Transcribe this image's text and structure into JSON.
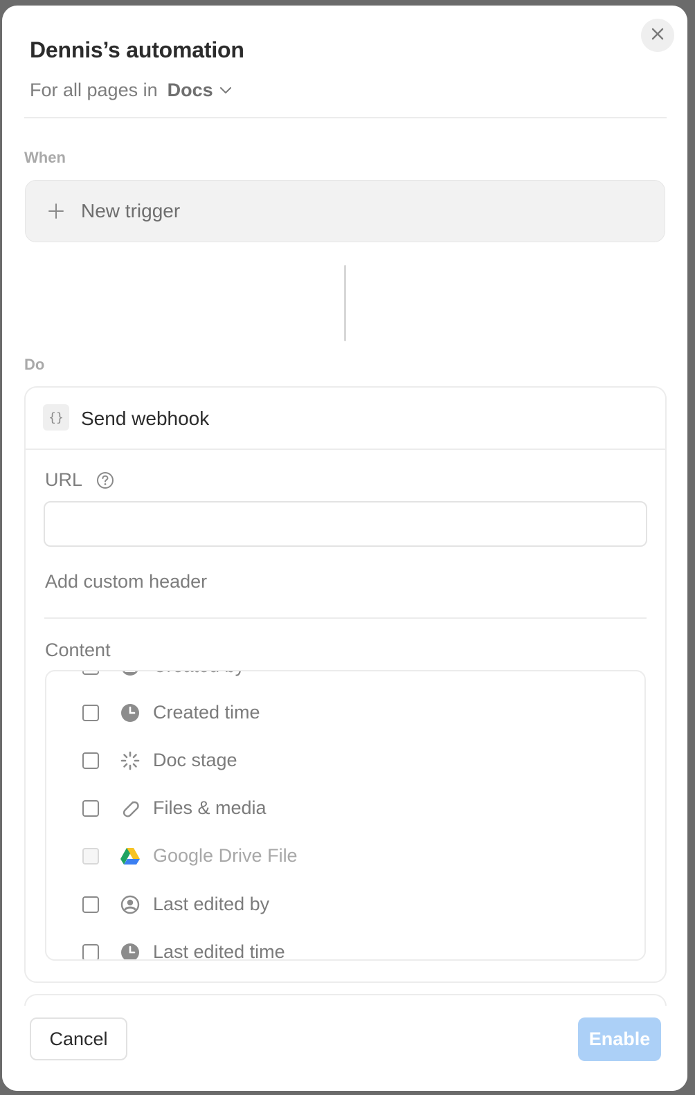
{
  "modal": {
    "title": "Dennis’s automation",
    "scope_prefix": "For all pages in",
    "scope_database": "Docs",
    "close_icon": "close-icon"
  },
  "when": {
    "label": "When",
    "new_trigger": "New trigger"
  },
  "do": {
    "label": "Do",
    "action": {
      "icon": "code-braces-icon",
      "icon_text": "{}",
      "title": "Send webhook",
      "url_label": "URL",
      "url_value": "",
      "add_header": "Add custom header",
      "content_label": "Content",
      "properties": [
        {
          "label": "Created by",
          "icon": "person-icon",
          "checked": false,
          "disabled": false
        },
        {
          "label": "Created time",
          "icon": "clock-icon",
          "checked": false,
          "disabled": false
        },
        {
          "label": "Doc stage",
          "icon": "status-icon",
          "checked": false,
          "disabled": false
        },
        {
          "label": "Files & media",
          "icon": "paperclip-icon",
          "checked": false,
          "disabled": false
        },
        {
          "label": "Google Drive File",
          "icon": "google-drive-icon",
          "checked": false,
          "disabled": true
        },
        {
          "label": "Last edited by",
          "icon": "person-icon",
          "checked": false,
          "disabled": false
        },
        {
          "label": "Last edited time",
          "icon": "clock-icon",
          "checked": false,
          "disabled": false
        }
      ]
    }
  },
  "footer": {
    "cancel": "Cancel",
    "enable": "Enable"
  },
  "colors": {
    "enable_button": "#acd0f7",
    "backdrop": "#6b6b6b"
  }
}
